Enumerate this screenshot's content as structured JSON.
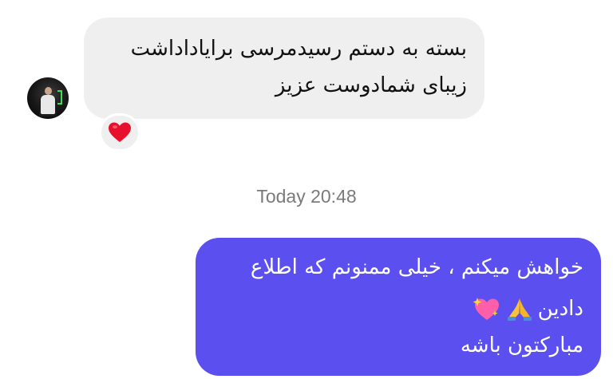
{
  "incoming_message": {
    "line1": "بسته به دستم رسیدمرسی برایاداداشت",
    "line2": "زیبای شمادوست عزیز",
    "reaction": "heart-icon"
  },
  "timestamp": {
    "label": "Today 20:48"
  },
  "outgoing_message": {
    "line1": "خواهش میکنم ، خیلی ممنونم که اطلاع",
    "line2": "دادین",
    "line2_emojis": [
      "folded-hands-icon",
      "sparkling-heart-icon"
    ],
    "line3": "مبارکتون باشه"
  },
  "colors": {
    "incoming_bubble": "#efefef",
    "outgoing_bubble": "#5b4ff0",
    "heart": "#e8112d",
    "timestamp_text": "#7a7a7a"
  }
}
